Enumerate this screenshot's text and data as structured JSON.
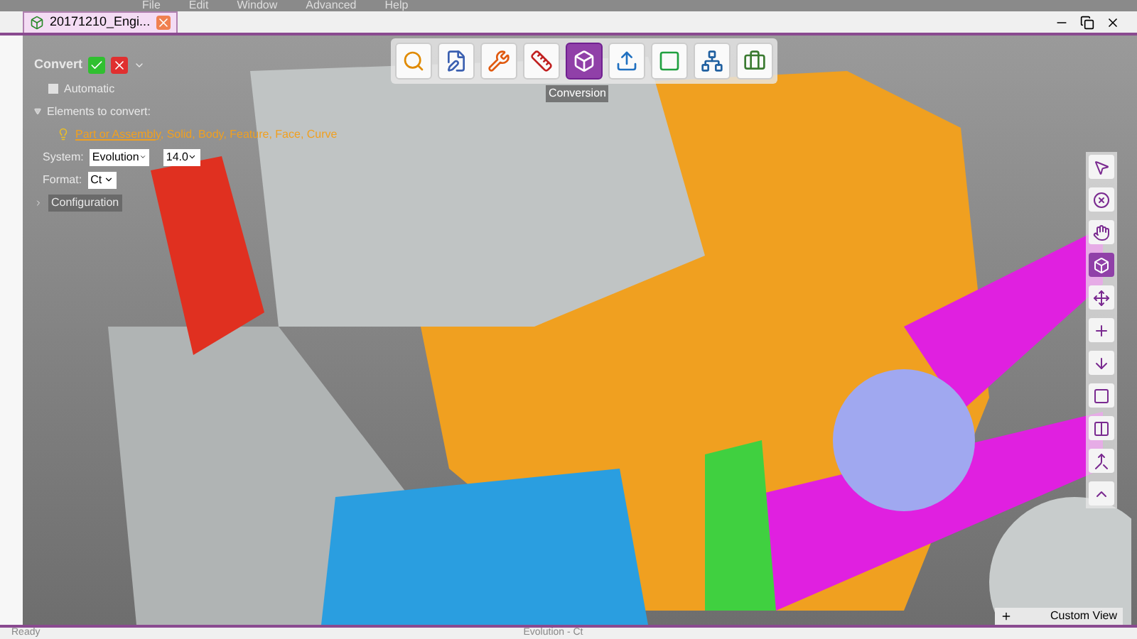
{
  "menu": [
    "File",
    "Edit",
    "Window",
    "Advanced",
    "Help"
  ],
  "tab": {
    "label": "20171210_Engi...",
    "selected": true
  },
  "panel": {
    "title": "Convert",
    "automatic": {
      "label": "Automatic",
      "checked": false
    },
    "elements": {
      "label": "Elements to convert:",
      "expanded": true,
      "link": "Part or Assembly",
      "rest": ", Solid, Body, Feature, Face, Curve"
    },
    "system": {
      "label": "System:",
      "value": "Evolution",
      "version": "14.0"
    },
    "format": {
      "label": "Format:",
      "value": "Ct"
    },
    "configuration": {
      "label": "Configuration",
      "expanded": false
    }
  },
  "toolbar": [
    {
      "kind": "search",
      "selected": false
    },
    {
      "kind": "edit",
      "selected": false
    },
    {
      "kind": "tools",
      "selected": false
    },
    {
      "kind": "measure",
      "selected": false
    },
    {
      "kind": "convert",
      "selected": true
    },
    {
      "kind": "export",
      "selected": false
    },
    {
      "kind": "frame",
      "selected": false
    },
    {
      "kind": "network",
      "selected": false
    },
    {
      "kind": "case",
      "selected": false
    }
  ],
  "tooltip": "Conversion",
  "side_toolbar": [
    {
      "kind": "pointer",
      "selected": false
    },
    {
      "kind": "circle-x",
      "selected": false
    },
    {
      "kind": "hand",
      "selected": false
    },
    {
      "kind": "convert",
      "selected": true
    },
    {
      "kind": "move",
      "selected": false
    },
    {
      "kind": "plus",
      "selected": false
    },
    {
      "kind": "arrow-down",
      "selected": false
    },
    {
      "kind": "box",
      "selected": false
    },
    {
      "kind": "split",
      "selected": false
    },
    {
      "kind": "merge",
      "selected": false
    },
    {
      "kind": "up",
      "selected": false
    }
  ],
  "view_tab": "Custom View",
  "status_bar": {
    "left": "Ready",
    "center": "Evolution - Ct"
  }
}
